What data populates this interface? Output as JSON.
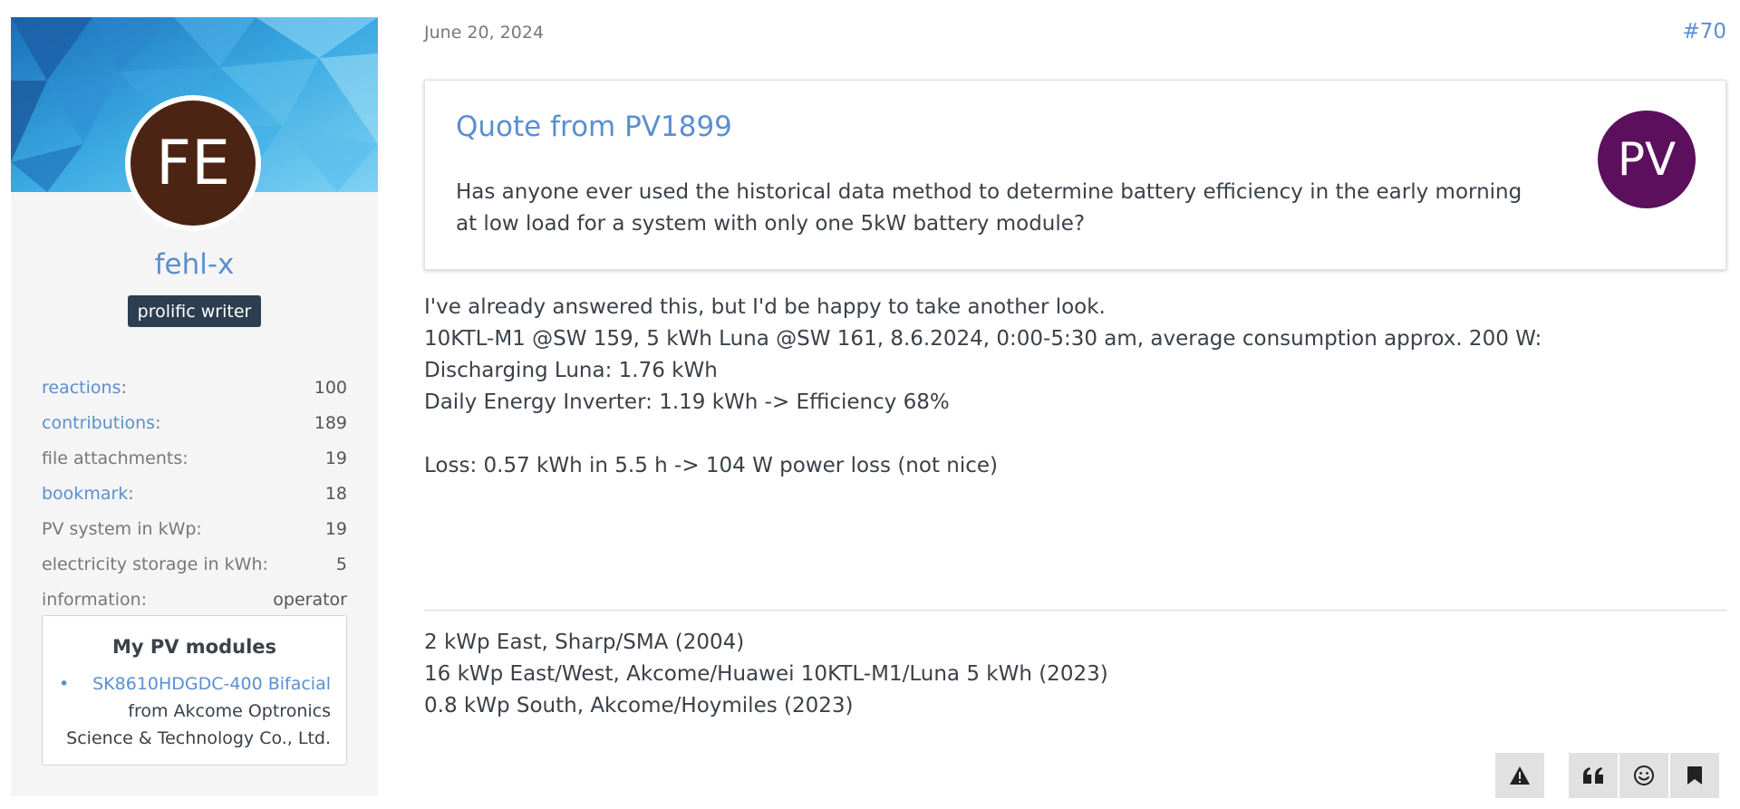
{
  "author": {
    "initials": "FE",
    "username": "fehl-x",
    "rank": "prolific writer",
    "stats": [
      {
        "label": "reactions",
        "value": "100",
        "link": true
      },
      {
        "label": "contributions",
        "value": "189",
        "link": true
      },
      {
        "label": "file attachments:",
        "value": "19",
        "link": false
      },
      {
        "label": "bookmark",
        "value": "18",
        "link": true
      },
      {
        "label": "PV system in kWp:",
        "value": "19",
        "link": false
      },
      {
        "label": "electricity storage in kWh:",
        "value": "5",
        "link": false
      },
      {
        "label": "information:",
        "value": "operator",
        "link": false
      }
    ],
    "modules": {
      "title": "My PV modules",
      "bullet": "•",
      "link_text": "SK8610HDGDC-400 Bifacial",
      "maker_line1": "from Akcome Optronics",
      "maker_line2": "Science & Technology Co., Ltd."
    }
  },
  "post": {
    "date": "June 20, 2024",
    "number": "#70",
    "quote": {
      "title": "Quote from PV1899",
      "avatar_initials": "PV",
      "text": "Has anyone ever used the historical data method to determine battery efficiency in the early morning at low load for a system with only one 5kW battery module?"
    },
    "body": {
      "line1": "I've already answered this, but I'd be happy to take another look.",
      "line2": "10KTL-M1 @SW 159, 5 kWh Luna @SW 161, 8.6.2024, 0:00-5:30 am, average consumption approx. 200 W:",
      "line3": "Discharging Luna: 1.76 kWh",
      "line4": "Daily Energy Inverter: 1.19 kWh -> Efficiency 68%",
      "line5": "Loss: 0.57 kWh in 5.5 h -> 104 W power loss (not nice)"
    },
    "signature": {
      "line1": "2 kWp East, Sharp/SMA (2004)",
      "line2": "16 kWp East/West, Akcome/Huawei 10KTL-M1/Luna 5 kWh (2023)",
      "line3": "0.8 kWp South, Akcome/Hoymiles (2023)"
    }
  },
  "actions": {
    "report": {
      "icon": "warning-icon",
      "label": "Report"
    },
    "quote": {
      "icon": "quote-icon",
      "label": "Quote"
    },
    "react": {
      "icon": "smiley-icon",
      "label": "React"
    },
    "bookmark": {
      "icon": "bookmark-icon",
      "label": "Bookmark"
    }
  },
  "colors": {
    "link": "#5a8fd0",
    "rank_badge": "#2c3e50",
    "author_avatar": "#4b2414",
    "quote_avatar": "#5b0f5c",
    "sidebar_bg": "#f5f5f5",
    "button_bg": "#e1e1e1"
  }
}
